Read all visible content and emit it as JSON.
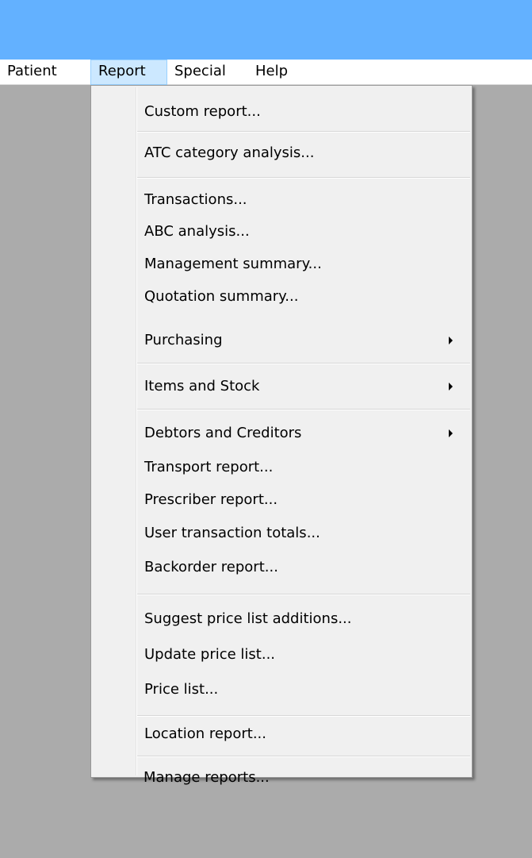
{
  "menubar": {
    "items": [
      {
        "label": "Patient"
      },
      {
        "label": "Report"
      },
      {
        "label": "Special"
      },
      {
        "label": "Help"
      }
    ]
  },
  "report_menu": {
    "items": [
      {
        "label": "Custom report..."
      },
      {
        "label": "ATC category analysis..."
      },
      {
        "label": "Transactions..."
      },
      {
        "label": "ABC analysis..."
      },
      {
        "label": "Management summary..."
      },
      {
        "label": "Quotation summary..."
      },
      {
        "label": "Purchasing"
      },
      {
        "label": "Items and Stock"
      },
      {
        "label": "Debtors and Creditors"
      },
      {
        "label": "Transport report..."
      },
      {
        "label": "Prescriber report..."
      },
      {
        "label": "User transaction totals..."
      },
      {
        "label": "Backorder report..."
      },
      {
        "label": "Suggest price list additions..."
      },
      {
        "label": "Update price list..."
      },
      {
        "label": "Price list..."
      },
      {
        "label": "Location report..."
      },
      {
        "label": "Manage reports..."
      }
    ]
  }
}
